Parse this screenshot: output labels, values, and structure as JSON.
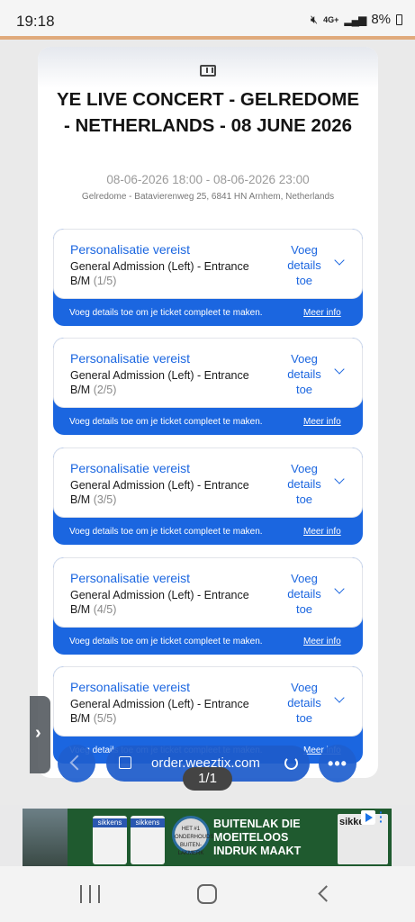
{
  "status_bar": {
    "time": "19:18",
    "battery": "8%",
    "network": "4G+"
  },
  "event": {
    "title": "YE LIVE CONCERT - GELREDOME - NETHERLANDS - 08 JUNE 2026",
    "datetime": "08-06-2026 18:00 - 08-06-2026 23:00",
    "address": "Gelredome - Batavierenweg 25, 6841 HN Arnhem, Netherlands"
  },
  "tickets": [
    {
      "status": "Personalisatie vereist",
      "type": "General Admission (Left) - Entrance B/M",
      "count": "(1/5)",
      "action": "Voeg details toe",
      "footer": "Voeg details toe om je ticket compleet te maken.",
      "more": "Meer info"
    },
    {
      "status": "Personalisatie vereist",
      "type": "General Admission (Left) - Entrance B/M",
      "count": "(2/5)",
      "action": "Voeg details toe",
      "footer": "Voeg details toe om je ticket compleet te maken.",
      "more": "Meer info"
    },
    {
      "status": "Personalisatie vereist",
      "type": "General Admission (Left) - Entrance B/M",
      "count": "(3/5)",
      "action": "Voeg details toe",
      "footer": "Voeg details toe om je ticket compleet te maken.",
      "more": "Meer info"
    },
    {
      "status": "Personalisatie vereist",
      "type": "General Admission (Left) - Entrance B/M",
      "count": "(4/5)",
      "action": "Voeg details toe",
      "footer": "Voeg details toe om je ticket compleet te maken.",
      "more": "Meer info"
    },
    {
      "status": "Personalisatie vereist",
      "type": "General Admission (Left) - Entrance B/M",
      "count": "(5/5)",
      "action": "Voeg details toe",
      "footer": "Voeg details toe om je ticket compleet te maken.",
      "more": "Meer info"
    }
  ],
  "browser": {
    "url": "order.weeztix.com",
    "page_indicator": "1/1"
  },
  "ad": {
    "brand": "sikkens",
    "headline_lines": [
      "BUITENLAK DIE",
      "MOEITELOOS",
      "INDRUK MAAKT"
    ],
    "badge_text": "HET #1 ONDERHOUDS BUITEN- LAKMERK"
  },
  "colors": {
    "accent": "#1b66e0",
    "status_divider": "#e0aa7c"
  }
}
